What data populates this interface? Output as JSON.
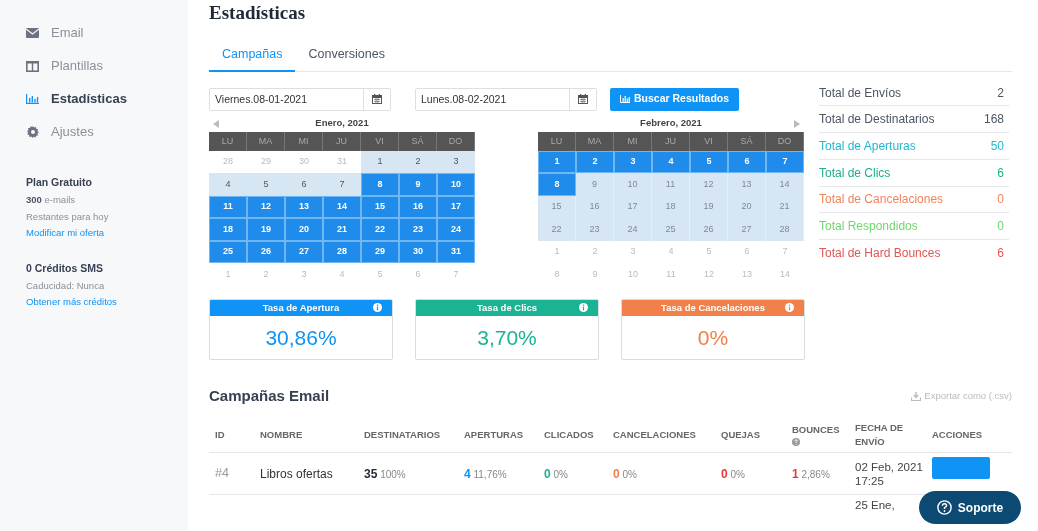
{
  "sidebar": {
    "items": [
      {
        "label": "Email",
        "selected": false
      },
      {
        "label": "Plantillas",
        "selected": false
      },
      {
        "label": "Estadísticas",
        "selected": true
      },
      {
        "label": "Ajustes",
        "selected": false
      }
    ],
    "plan": {
      "title": "Plan Gratuito",
      "count": "300",
      "count_unit": "e-mails",
      "note": "Restantes para hoy",
      "link": "Modificar mi oferta"
    },
    "sms": {
      "title": "0 Créditos SMS",
      "note": "Caducidad: Nunca",
      "link": "Obtener más créditos"
    }
  },
  "title": "Estadísticas",
  "tabs": [
    {
      "label": "Campañas",
      "selected": true
    },
    {
      "label": "Conversiones",
      "selected": false
    }
  ],
  "date_from": "Viernes.08-01-2021",
  "date_to": "Lunes.08-02-2021",
  "search_button": "Buscar Resultados",
  "calendars": [
    {
      "month": "Enero, 2021",
      "weekdays": [
        "LU",
        "MA",
        "MI",
        "JU",
        "VI",
        "SÁ",
        "DO"
      ],
      "weeks": [
        [
          {
            "d": "28",
            "kind": "other"
          },
          {
            "d": "29",
            "kind": "other"
          },
          {
            "d": "30",
            "kind": "other"
          },
          {
            "d": "31",
            "kind": "other"
          },
          {
            "d": "1",
            "kind": "range"
          },
          {
            "d": "2",
            "kind": "range"
          },
          {
            "d": "3",
            "kind": "range"
          }
        ],
        [
          {
            "d": "4",
            "kind": "range"
          },
          {
            "d": "5",
            "kind": "range"
          },
          {
            "d": "6",
            "kind": "range"
          },
          {
            "d": "7",
            "kind": "range"
          },
          {
            "d": "8",
            "kind": "selected"
          },
          {
            "d": "9",
            "kind": "selected"
          },
          {
            "d": "10",
            "kind": "selected"
          }
        ],
        [
          {
            "d": "11",
            "kind": "selected"
          },
          {
            "d": "12",
            "kind": "selected"
          },
          {
            "d": "13",
            "kind": "selected"
          },
          {
            "d": "14",
            "kind": "selected"
          },
          {
            "d": "15",
            "kind": "selected"
          },
          {
            "d": "16",
            "kind": "selected"
          },
          {
            "d": "17",
            "kind": "selected"
          }
        ],
        [
          {
            "d": "18",
            "kind": "selected"
          },
          {
            "d": "19",
            "kind": "selected"
          },
          {
            "d": "20",
            "kind": "selected"
          },
          {
            "d": "21",
            "kind": "selected"
          },
          {
            "d": "22",
            "kind": "selected"
          },
          {
            "d": "23",
            "kind": "selected"
          },
          {
            "d": "24",
            "kind": "selected"
          }
        ],
        [
          {
            "d": "25",
            "kind": "selected"
          },
          {
            "d": "26",
            "kind": "selected"
          },
          {
            "d": "27",
            "kind": "selected"
          },
          {
            "d": "28",
            "kind": "selected"
          },
          {
            "d": "29",
            "kind": "selected"
          },
          {
            "d": "30",
            "kind": "selected"
          },
          {
            "d": "31",
            "kind": "selected"
          }
        ],
        [
          {
            "d": "1",
            "kind": "other"
          },
          {
            "d": "2",
            "kind": "other"
          },
          {
            "d": "3",
            "kind": "other"
          },
          {
            "d": "4",
            "kind": "other"
          },
          {
            "d": "5",
            "kind": "other"
          },
          {
            "d": "6",
            "kind": "other"
          },
          {
            "d": "7",
            "kind": "other"
          }
        ]
      ]
    },
    {
      "month": "Febrero, 2021",
      "weekdays": [
        "LU",
        "MA",
        "MI",
        "JU",
        "VI",
        "SÁ",
        "DO"
      ],
      "weeks": [
        [
          {
            "d": "1",
            "kind": "selected"
          },
          {
            "d": "2",
            "kind": "selected"
          },
          {
            "d": "3",
            "kind": "selected"
          },
          {
            "d": "4",
            "kind": "selected"
          },
          {
            "d": "5",
            "kind": "selected"
          },
          {
            "d": "6",
            "kind": "selected"
          },
          {
            "d": "7",
            "kind": "selected"
          }
        ],
        [
          {
            "d": "8",
            "kind": "selected"
          },
          {
            "d": "9",
            "kind": "disabled"
          },
          {
            "d": "10",
            "kind": "disabled"
          },
          {
            "d": "11",
            "kind": "disabled"
          },
          {
            "d": "12",
            "kind": "disabled"
          },
          {
            "d": "13",
            "kind": "disabled"
          },
          {
            "d": "14",
            "kind": "disabled"
          }
        ],
        [
          {
            "d": "15",
            "kind": "disabled"
          },
          {
            "d": "16",
            "kind": "disabled"
          },
          {
            "d": "17",
            "kind": "disabled"
          },
          {
            "d": "18",
            "kind": "disabled"
          },
          {
            "d": "19",
            "kind": "disabled"
          },
          {
            "d": "20",
            "kind": "disabled"
          },
          {
            "d": "21",
            "kind": "disabled"
          }
        ],
        [
          {
            "d": "22",
            "kind": "disabled"
          },
          {
            "d": "23",
            "kind": "disabled"
          },
          {
            "d": "24",
            "kind": "disabled"
          },
          {
            "d": "25",
            "kind": "disabled"
          },
          {
            "d": "26",
            "kind": "disabled"
          },
          {
            "d": "27",
            "kind": "disabled"
          },
          {
            "d": "28",
            "kind": "disabled"
          }
        ],
        [
          {
            "d": "1",
            "kind": "other"
          },
          {
            "d": "2",
            "kind": "other"
          },
          {
            "d": "3",
            "kind": "other"
          },
          {
            "d": "4",
            "kind": "other"
          },
          {
            "d": "5",
            "kind": "other"
          },
          {
            "d": "6",
            "kind": "other"
          },
          {
            "d": "7",
            "kind": "other"
          }
        ],
        [
          {
            "d": "8",
            "kind": "other"
          },
          {
            "d": "9",
            "kind": "other"
          },
          {
            "d": "10",
            "kind": "other"
          },
          {
            "d": "11",
            "kind": "other"
          },
          {
            "d": "12",
            "kind": "other"
          },
          {
            "d": "13",
            "kind": "other"
          },
          {
            "d": "14",
            "kind": "other"
          }
        ]
      ]
    }
  ],
  "totals": [
    {
      "label": "Total de Envíos",
      "value": "2",
      "color": "#4b5563"
    },
    {
      "label": "Total de Destinatarios",
      "value": "168",
      "color": "#4b5563"
    },
    {
      "label": "Total de Aperturas",
      "value": "50",
      "color": "#22b8cf"
    },
    {
      "label": "Total de Clics",
      "value": "6",
      "color": "#1aae8a"
    },
    {
      "label": "Total de Cancelaciones",
      "value": "0",
      "color": "#f0845a"
    },
    {
      "label": "Total Respondidos",
      "value": "0",
      "color": "#6fd66f"
    },
    {
      "label": "Total de Hard Bounces",
      "value": "6",
      "color": "#e05555"
    }
  ],
  "rate_cards": [
    {
      "title": "Tasa de Apertura",
      "value": "30,86%",
      "color": "#0f93f5"
    },
    {
      "title": "Tasa de Clics",
      "value": "3,70%",
      "color": "#1ab394"
    },
    {
      "title": "Tasa de Cancelaciones",
      "value": "0%",
      "color": "#f2804a"
    }
  ],
  "campaigns": {
    "title": "Campañas Email",
    "export": "Exportar como (.csv)",
    "columns": [
      {
        "label": "ID",
        "help": false
      },
      {
        "label": "NOMBRE",
        "help": false
      },
      {
        "label": "DESTINATARIOS",
        "help": false
      },
      {
        "label": "APERTURAS",
        "help": false
      },
      {
        "label": "CLICADOS",
        "help": false
      },
      {
        "label": "CANCELACIONES",
        "help": false
      },
      {
        "label": "QUEJAS",
        "help": false
      },
      {
        "label": "BOUNCES",
        "help": true
      },
      {
        "label": "FECHA DE ENVÍO",
        "help": false
      },
      {
        "label": "ACCIONES",
        "help": false
      }
    ],
    "rows": [
      {
        "id": "#4",
        "name": "Libros ofertas",
        "metrics": [
          {
            "value": "35",
            "pct": "100%",
            "color": "#1f2937"
          },
          {
            "value": "4",
            "pct": "11,76%",
            "color": "#0f93f5"
          },
          {
            "value": "0",
            "pct": "0%",
            "color": "#1ab394"
          },
          {
            "value": "0",
            "pct": "0%",
            "color": "#f2804a"
          },
          {
            "value": "0",
            "pct": "0%",
            "color": "#e03c3c"
          },
          {
            "value": "1",
            "pct": "2,86%",
            "color": "#e03c3c"
          }
        ],
        "date": "02 Feb, 2021 17:25"
      },
      {
        "date": "25 Ene,"
      }
    ]
  },
  "support_button": "Soporte"
}
